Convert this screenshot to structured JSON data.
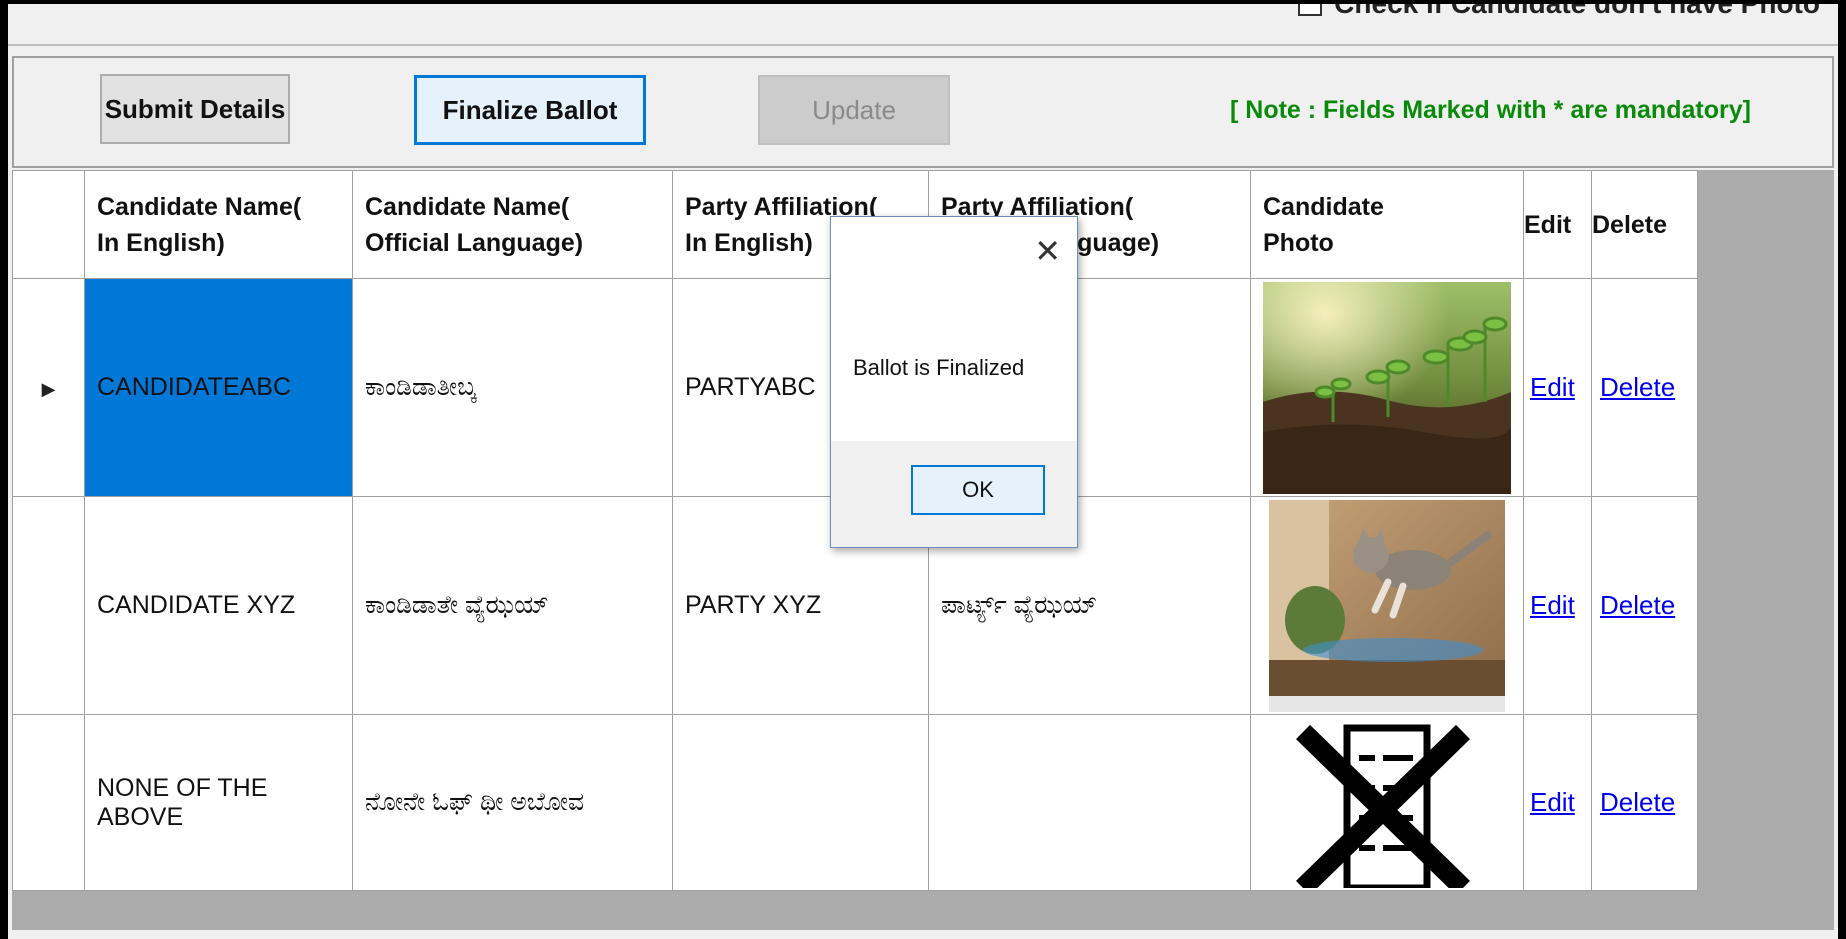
{
  "header": {
    "photo_checkbox_label": "Check if Candidate don't have Photo"
  },
  "toolbar": {
    "submit_label": "Submit Details",
    "finalize_label": "Finalize Ballot",
    "update_label": "Update",
    "note": "[ Note : Fields Marked with * are mandatory]"
  },
  "grid": {
    "columns": [
      {
        "line1": "Candidate Name(",
        "line2": "In English)"
      },
      {
        "line1": "Candidate Name(",
        "line2": "Official Language)"
      },
      {
        "line1": "Party Affiliation(",
        "line2": "In English)"
      },
      {
        "line1": "Party Affiliation(",
        "line2": "Official Language)"
      },
      {
        "line1": "Candidate",
        "line2": "Photo"
      },
      {
        "line1": "Edit",
        "line2": ""
      },
      {
        "line1": "Delete",
        "line2": ""
      }
    ],
    "rows": [
      {
        "name_en": "CANDIDATEABC",
        "name_official": "ಕಾಂಡಿಡಾತೀಬ್ಕ",
        "party_en": "PARTYABC",
        "party_official": "",
        "photo": "seedlings-photo",
        "edit": "Edit",
        "delete": "Delete"
      },
      {
        "name_en": "CANDIDATE XYZ",
        "name_official": "ಕಾಂಡಿಡಾತೇ ವ್ಯೆಝಯ್",
        "party_en": "PARTY XYZ",
        "party_official": "ಪಾರ್ಟ್ಯ್ ವ್ಯೆಝಯ್",
        "photo": "cat-photo",
        "edit": "Edit",
        "delete": "Delete"
      },
      {
        "name_en": "NONE OF THE ABOVE",
        "name_official": "ನೋನೇ ಓಫ್ ಥೀ ಅಬೋವ",
        "party_en": "",
        "party_official": "",
        "photo": "nota-symbol",
        "edit": "Edit",
        "delete": "Delete"
      }
    ]
  },
  "dialog": {
    "message": "Ballot is Finalized",
    "ok_label": "OK"
  },
  "colors": {
    "selection": "#0078d7",
    "note_green": "#0a8a0a",
    "link": "#0000ee"
  }
}
